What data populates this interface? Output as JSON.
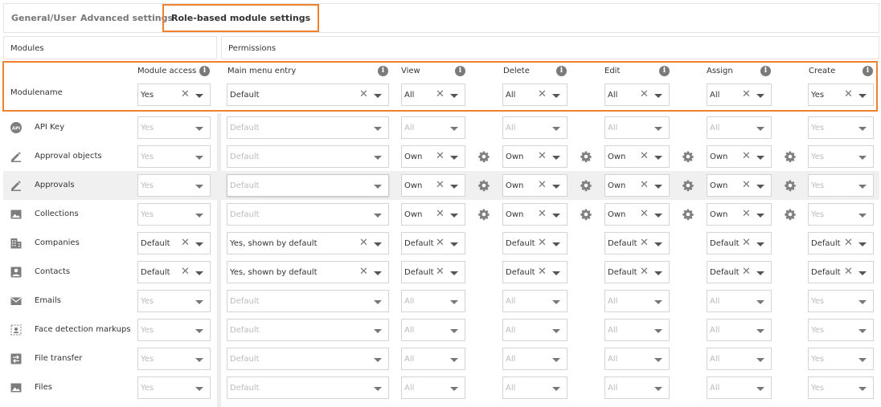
{
  "tabs": [
    {
      "label": "General/User",
      "active": false
    },
    {
      "label": "Advanced settings",
      "active": false
    },
    {
      "label": "Role-based module settings",
      "active": true
    }
  ],
  "sections": {
    "modules": "Modules",
    "permissions": "Permissions"
  },
  "header": {
    "modulename": "Modulename",
    "columns": [
      {
        "label": "Module access",
        "value": "Yes"
      },
      {
        "label": "Main menu entry",
        "value": "Default"
      },
      {
        "label": "View",
        "value": "All"
      },
      {
        "label": "Delete",
        "value": "All"
      },
      {
        "label": "Edit",
        "value": "All"
      },
      {
        "label": "Assign",
        "value": "All"
      },
      {
        "label": "Create",
        "value": "Yes"
      }
    ]
  },
  "rows": [
    {
      "name": "API Key",
      "icon": "api-icon",
      "access": "Yes",
      "menu": "Default",
      "perms": [
        "All",
        "All",
        "All",
        "All"
      ],
      "create": "Yes",
      "enabled": false,
      "gear": false,
      "shaded": false
    },
    {
      "name": "Approval objects",
      "icon": "approval-icon",
      "access": "Yes",
      "menu": "Default",
      "perms": [
        "Own",
        "Own",
        "Own",
        "Own"
      ],
      "create": "Yes",
      "enabled": false,
      "gear": true,
      "shaded": false
    },
    {
      "name": "Approvals",
      "icon": "approval-icon",
      "access": "Yes",
      "menu": "Default",
      "perms": [
        "Own",
        "Own",
        "Own",
        "Own"
      ],
      "create": "Yes",
      "enabled": false,
      "gear": true,
      "shaded": true
    },
    {
      "name": "Collections",
      "icon": "image-icon",
      "access": "Yes",
      "menu": "Default",
      "perms": [
        "Own",
        "Own",
        "Own",
        "Own"
      ],
      "create": "Yes",
      "enabled": false,
      "gear": true,
      "shaded": false
    },
    {
      "name": "Companies",
      "icon": "building-icon",
      "access": "Default",
      "menu": "Yes, shown by default",
      "perms": [
        "Default",
        "Default",
        "Default",
        "Default"
      ],
      "create": "Default",
      "enabled": true,
      "gear": false,
      "shaded": false
    },
    {
      "name": "Contacts",
      "icon": "contact-icon",
      "access": "Default",
      "menu": "Yes, shown by default",
      "perms": [
        "Default",
        "Default",
        "Default",
        "Default"
      ],
      "create": "Default",
      "enabled": true,
      "gear": false,
      "shaded": false
    },
    {
      "name": "Emails",
      "icon": "email-icon",
      "access": "Yes",
      "menu": "Default",
      "perms": [
        "All",
        "All",
        "All",
        "All"
      ],
      "create": "Yes",
      "enabled": false,
      "gear": false,
      "shaded": false
    },
    {
      "name": "Face detection markups",
      "icon": "face-icon",
      "access": "Yes",
      "menu": "Default",
      "perms": [
        "All",
        "All",
        "All",
        "All"
      ],
      "create": "Yes",
      "enabled": false,
      "gear": false,
      "shaded": false
    },
    {
      "name": "File transfer",
      "icon": "transfer-icon",
      "access": "Yes",
      "menu": "Default",
      "perms": [
        "All",
        "All",
        "All",
        "All"
      ],
      "create": "Yes",
      "enabled": false,
      "gear": false,
      "shaded": false
    },
    {
      "name": "Files",
      "icon": "image-icon",
      "access": "Yes",
      "menu": "Default",
      "perms": [
        "All",
        "All",
        "All",
        "All"
      ],
      "create": "Yes",
      "enabled": false,
      "gear": false,
      "shaded": false
    }
  ]
}
